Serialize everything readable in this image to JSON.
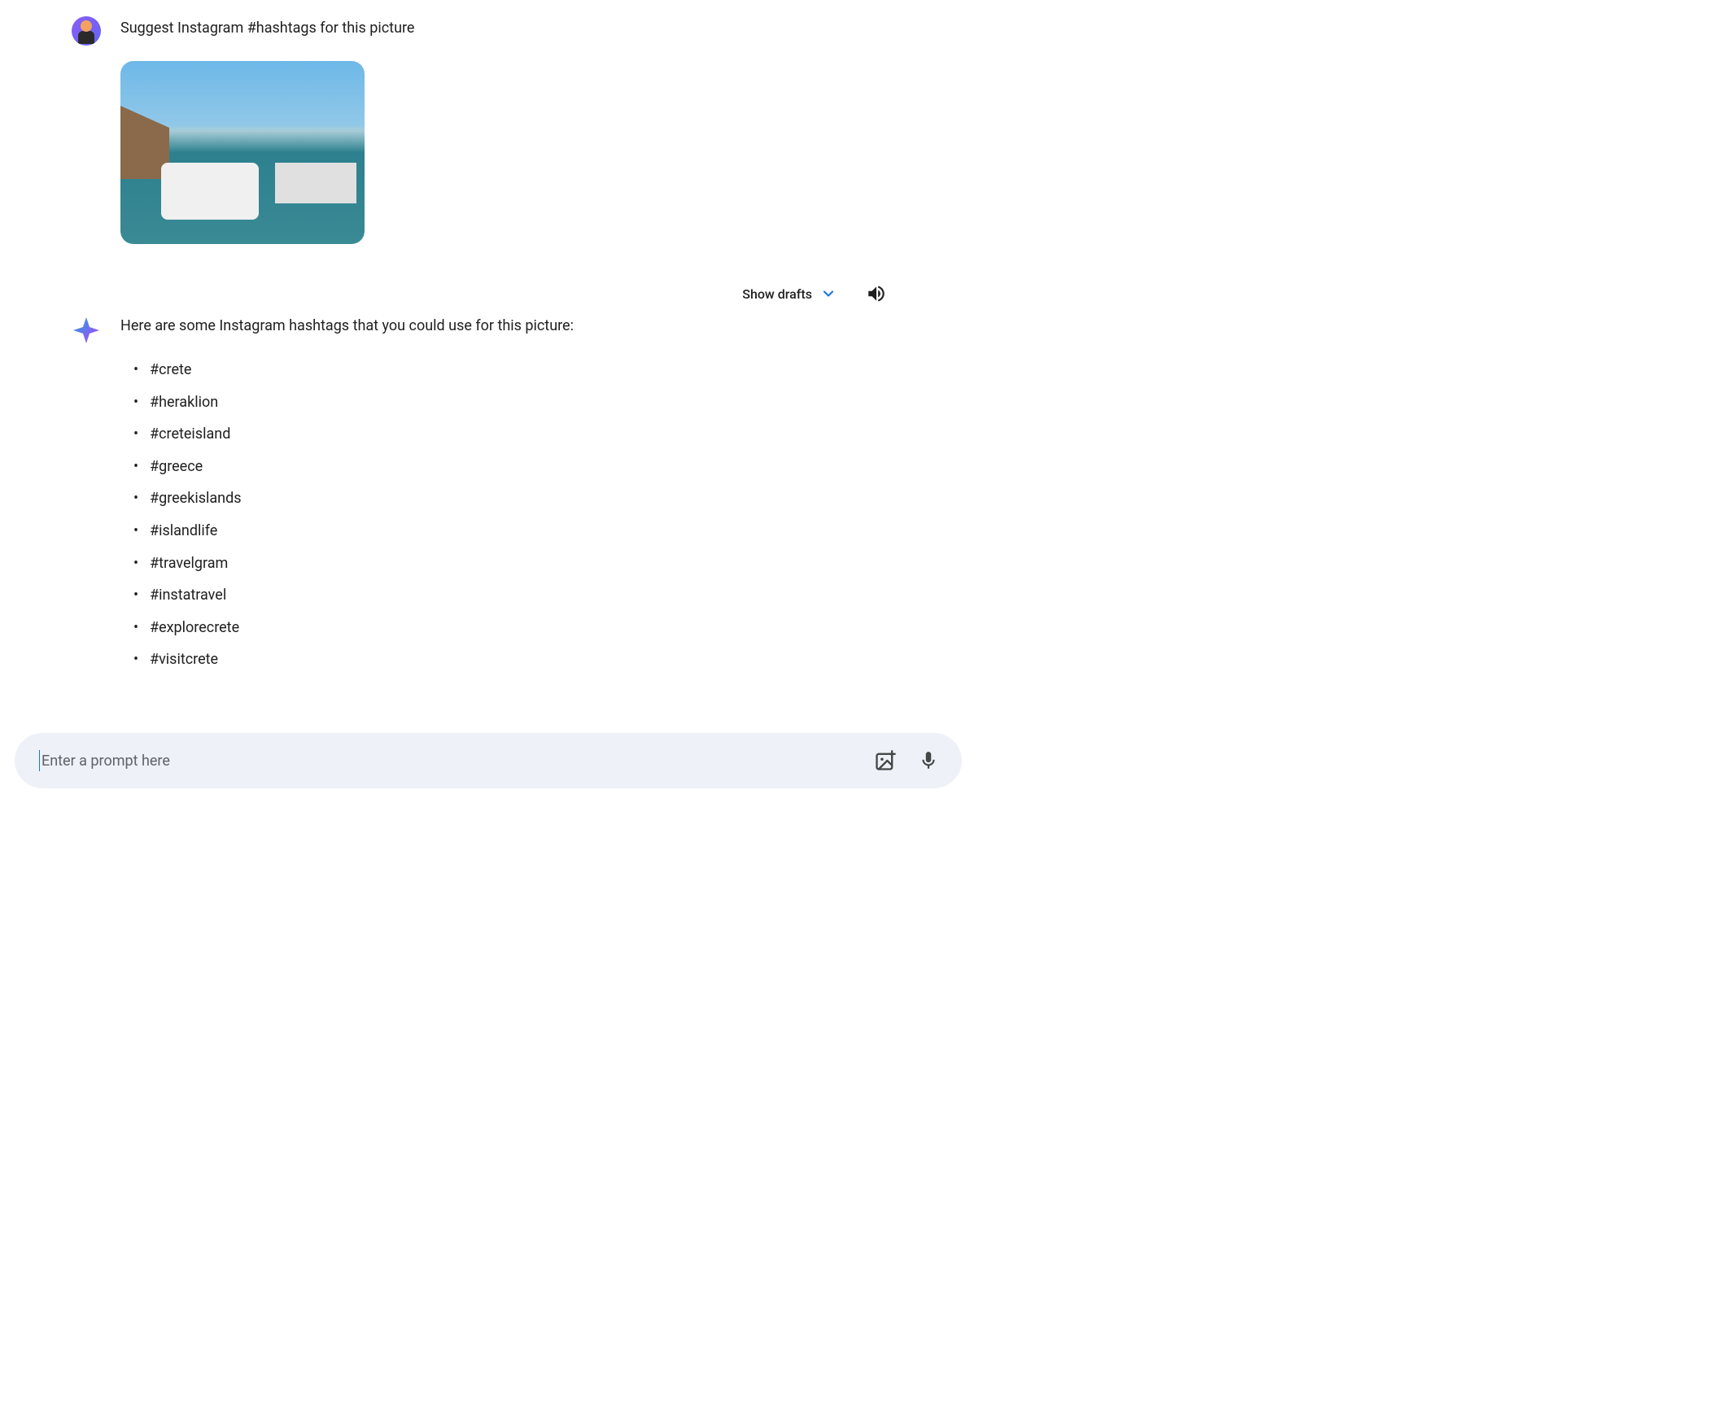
{
  "user_message": {
    "text": "Suggest Instagram #hashtags for this picture",
    "avatar_label": "user-avatar",
    "image_alt": "harbor-photo"
  },
  "actions": {
    "show_drafts_label": "Show drafts"
  },
  "ai_response": {
    "intro": "Here are some Instagram hashtags that you could use for this picture:",
    "hashtags": [
      "#crete",
      "#heraklion",
      "#creteisland",
      "#greece",
      "#greekislands",
      "#islandlife",
      "#travelgram",
      "#instatravel",
      "#explorecrete",
      "#visitcrete"
    ]
  },
  "input": {
    "placeholder": "Enter a prompt here"
  }
}
